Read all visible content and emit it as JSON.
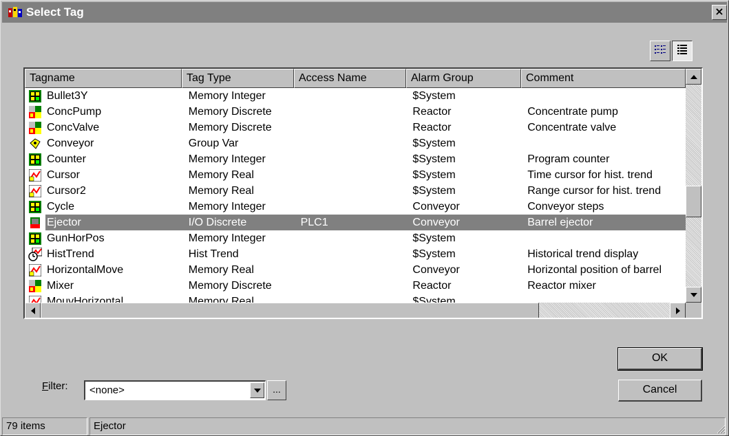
{
  "window": {
    "title": "Select Tag",
    "close_label": "×"
  },
  "toolbar": {
    "view_buttons": [
      "list-view-icon",
      "details-view-icon"
    ],
    "active_view": "details"
  },
  "list": {
    "columns": [
      "Tagname",
      "Tag Type",
      "Access Name",
      "Alarm Group",
      "Comment"
    ],
    "rows": [
      {
        "icon": "memory-integer-icon",
        "name": "Bullet3Y",
        "type": "Memory Integer",
        "access": "",
        "alarm": "$System",
        "comment": ""
      },
      {
        "icon": "memory-discrete-icon",
        "name": "ConcPump",
        "type": "Memory Discrete",
        "access": "",
        "alarm": "Reactor",
        "comment": "Concentrate pump"
      },
      {
        "icon": "memory-discrete-icon",
        "name": "ConcValve",
        "type": "Memory Discrete",
        "access": "",
        "alarm": "Reactor",
        "comment": "Concentrate valve"
      },
      {
        "icon": "group-var-icon",
        "name": "Conveyor",
        "type": "Group Var",
        "access": "",
        "alarm": "$System",
        "comment": ""
      },
      {
        "icon": "memory-integer-icon",
        "name": "Counter",
        "type": "Memory Integer",
        "access": "",
        "alarm": "$System",
        "comment": "Program counter"
      },
      {
        "icon": "memory-real-icon",
        "name": "Cursor",
        "type": "Memory Real",
        "access": "",
        "alarm": "$System",
        "comment": "Time cursor for hist. trend"
      },
      {
        "icon": "memory-real-icon",
        "name": "Cursor2",
        "type": "Memory Real",
        "access": "",
        "alarm": "$System",
        "comment": "Range cursor for hist. trend"
      },
      {
        "icon": "memory-integer-icon",
        "name": "Cycle",
        "type": "Memory Integer",
        "access": "",
        "alarm": "Conveyor",
        "comment": "Conveyor steps"
      },
      {
        "icon": "io-discrete-icon",
        "name": "Ejector",
        "type": "I/O Discrete",
        "access": "PLC1",
        "alarm": "Conveyor",
        "comment": "Barrel ejector",
        "selected": true
      },
      {
        "icon": "memory-integer-icon",
        "name": "GunHorPos",
        "type": "Memory Integer",
        "access": "",
        "alarm": "$System",
        "comment": ""
      },
      {
        "icon": "hist-trend-icon",
        "name": "HistTrend",
        "type": "Hist Trend",
        "access": "",
        "alarm": "$System",
        "comment": "Historical trend display"
      },
      {
        "icon": "memory-real-icon",
        "name": "HorizontalMove",
        "type": "Memory Real",
        "access": "",
        "alarm": "Conveyor",
        "comment": "Horizontal position of barrel"
      },
      {
        "icon": "memory-discrete-icon",
        "name": "Mixer",
        "type": "Memory Discrete",
        "access": "",
        "alarm": "Reactor",
        "comment": "Reactor mixer"
      },
      {
        "icon": "memory-real-icon",
        "name": "MouvHorizontal",
        "type": "Memory Real",
        "access": "",
        "alarm": "$System",
        "comment": ""
      }
    ]
  },
  "buttons": {
    "ok": "OK",
    "cancel": "Cancel"
  },
  "filter": {
    "label_underlined": "F",
    "label_rest": "ilter:",
    "value": "<none>",
    "browse_label": "..."
  },
  "status": {
    "count": "79 items",
    "selected": "Ejector"
  },
  "colors": {
    "titlebar": "#808080",
    "face": "#c0c0c0",
    "selection": "#808080"
  }
}
